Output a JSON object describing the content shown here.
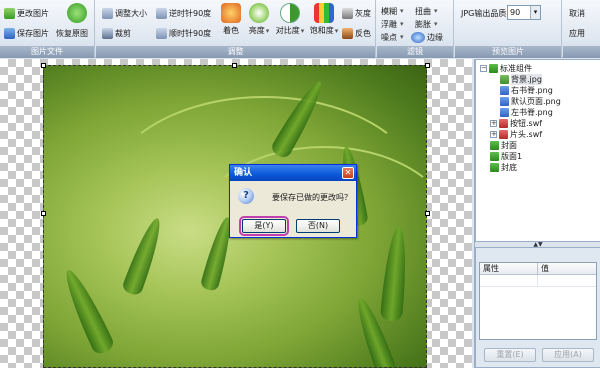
{
  "ribbon": {
    "file_group": {
      "label": "图片文件",
      "change_image": "更改图片",
      "save_image": "保存图片",
      "restore_original": "恢复原图"
    },
    "adjust_group": {
      "label": "调整",
      "resize": "调整大小",
      "crop": "裁剪",
      "rotate_ccw": "逆时针90度",
      "rotate_cw": "顺时针90度",
      "colorize": "着色",
      "brightness": "亮度",
      "contrast": "对比度",
      "saturation": "饱和度",
      "grayscale": "灰度",
      "invert": "反色"
    },
    "filter_group": {
      "label": "滤镜",
      "blur": "模糊",
      "emboss": "浮雕",
      "noise": "噪点",
      "distort": "扭曲",
      "bulge": "膨胀",
      "edge": "边缘"
    },
    "preview_group": {
      "label": "预览图片",
      "jpg_quality_label": "JPG输出品质",
      "jpg_quality_value": "90",
      "cancel": "取消",
      "apply": "应用"
    }
  },
  "dialog": {
    "title": "确认",
    "message": "要保存已做的更改吗？",
    "yes": "是(Y)",
    "no": "否(N)"
  },
  "tree": {
    "nodes": [
      {
        "label": "标准组件",
        "icon": "folder-icon",
        "toggle": "−"
      },
      {
        "label": "背景.jpg",
        "icon": "jpg-icon",
        "selected": true
      },
      {
        "label": "右书脊.png",
        "icon": "png-icon"
      },
      {
        "label": "默认页面.png",
        "icon": "png-icon"
      },
      {
        "label": "左书脊.png",
        "icon": "png-icon"
      },
      {
        "label": "按钮.swf",
        "icon": "swf-icon",
        "toggle": "+"
      },
      {
        "label": "片头.swf",
        "icon": "swf-icon",
        "toggle": "+"
      },
      {
        "label": "封面",
        "icon": "folder-icon"
      },
      {
        "label": "版面1",
        "icon": "folder-icon"
      },
      {
        "label": "封底",
        "icon": "folder-icon"
      }
    ]
  },
  "properties": {
    "col_name": "属性",
    "col_value": "值",
    "reset": "重置(E)",
    "apply": "应用(A)"
  },
  "colors": {
    "ribbon_bg": "#dfe7f1",
    "dialog_title": "#0a58d8",
    "highlight": "#c23fb0"
  }
}
